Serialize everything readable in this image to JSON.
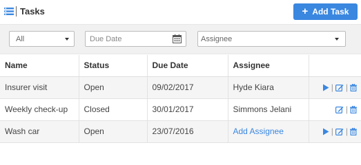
{
  "header": {
    "title": "Tasks",
    "add_button_label": "Add Task",
    "add_icon": "plus-icon",
    "title_icon": "list-icon"
  },
  "filters": {
    "status_value": "All",
    "due_date_placeholder": "Due Date",
    "assignee_value": "Assignee"
  },
  "table": {
    "columns": [
      "Name",
      "Status",
      "Due Date",
      "Assignee",
      ""
    ],
    "rows": [
      {
        "name": "Insurer visit",
        "status": "Open",
        "due_date": "09/02/2017",
        "assignee": "Hyde Kiara",
        "assignee_is_link": false,
        "has_start": true
      },
      {
        "name": "Weekly check-up",
        "status": "Closed",
        "due_date": "30/01/2017",
        "assignee": "Simmons Jelani",
        "assignee_is_link": false,
        "has_start": false
      },
      {
        "name": "Wash car",
        "status": "Open",
        "due_date": "23/07/2016",
        "assignee": "Add Assignee",
        "assignee_is_link": true,
        "has_start": true
      }
    ]
  },
  "colors": {
    "accent": "#3a87e0",
    "filter_bg": "#f1f1f1",
    "row_alt": "#f5f5f5"
  }
}
